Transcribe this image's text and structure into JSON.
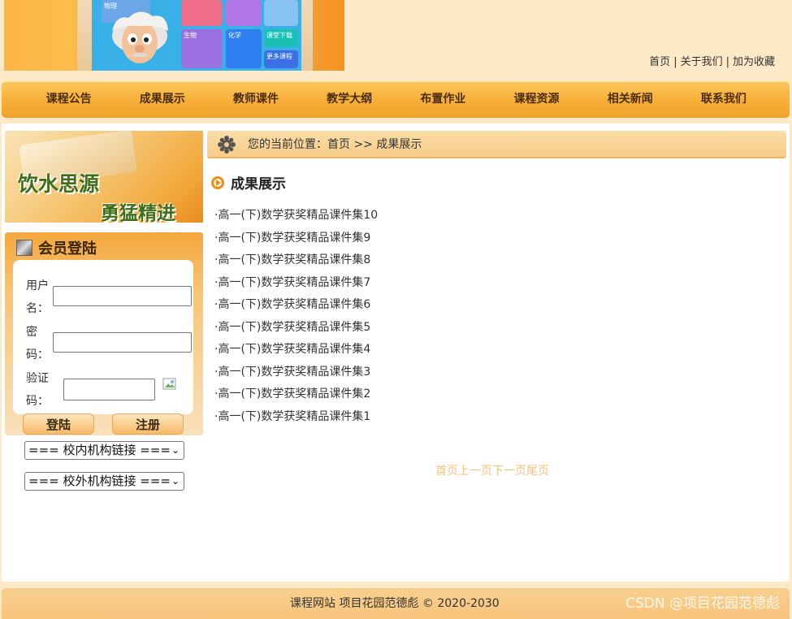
{
  "header": {
    "banner_labels": [
      "物理",
      "生物",
      "化学",
      "课堂下载",
      "更多课程"
    ],
    "top_links": [
      "首页",
      "关于我们",
      "加为收藏"
    ],
    "separator": "|"
  },
  "nav": {
    "items": [
      "课程公告",
      "成果展示",
      "教师课件",
      "教学大纲",
      "布置作业",
      "课程资源",
      "相关新闻",
      "联系我们"
    ]
  },
  "sidebar": {
    "promo_line1": "饮水思源",
    "promo_line2": "勇猛精进",
    "login_title": "会员登陆",
    "username_label": "用户名：",
    "password_label": "密码：",
    "captcha_label": "验证码：",
    "username_value": "",
    "password_value": "",
    "captcha_value": "",
    "login_button": "登陆",
    "register_button": "注册",
    "internal_links_select": "=== 校内机构链接 ===",
    "external_links_select": "=== 校外机构链接 ==="
  },
  "breadcrumb": {
    "text": "您的当前位置：首页 >> 成果展示"
  },
  "section": {
    "title": "成果展示",
    "items": [
      "·高一(下)数学获奖精品课件集10",
      "·高一(下)数学获奖精品课件集9",
      "·高一(下)数学获奖精品课件集8",
      "·高一(下)数学获奖精品课件集7",
      "·高一(下)数学获奖精品课件集6",
      "·高一(下)数学获奖精品课件集5",
      "·高一(下)数学获奖精品课件集4",
      "·高一(下)数学获奖精品课件集3",
      "·高一(下)数学获奖精品课件集2",
      "·高一(下)数学获奖精品课件集1"
    ]
  },
  "pager": {
    "first": "首页",
    "prev": "上一页",
    "next": "下一页",
    "last": "尾页"
  },
  "footer": {
    "copyright": "课程网站 项目花园范德彪 © 2020-2030",
    "watermark": "CSDN @项目花园范德彪"
  },
  "colors": {
    "page_bg": "#fde8c8",
    "nav_orange": "#f8b23e",
    "accent": "#f28c18",
    "pager_text": "#f5c37d"
  }
}
